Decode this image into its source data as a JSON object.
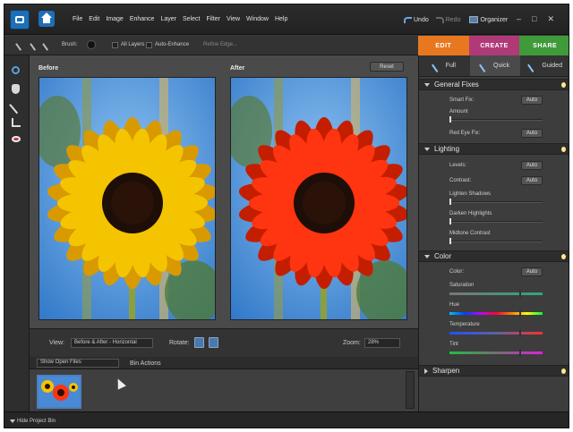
{
  "menubar": {
    "items": [
      "File",
      "Edit",
      "Image",
      "Enhance",
      "Layer",
      "Select",
      "Filter",
      "View",
      "Window",
      "Help"
    ],
    "undo_label": "Undo",
    "redo_label": "Redo",
    "organizer_label": "Organizer",
    "minimize": "–",
    "restore": "□",
    "close": "✕"
  },
  "options": {
    "brush_label": "Brush:",
    "all_layers_label": "All Layers",
    "auto_enhance_label": "Auto-Enhance",
    "refine_edge_label": "Refine Edge..."
  },
  "modes": {
    "edit": "EDIT",
    "create": "CREATE",
    "share": "SHARE"
  },
  "canvas": {
    "before_label": "Before",
    "after_label": "After",
    "reset_label": "Reset"
  },
  "viewbar": {
    "view_label": "View:",
    "view_value": "Before & After - Horizontal",
    "rotate_label": "Rotate:",
    "zoom_label": "Zoom:",
    "zoom_value": "28%"
  },
  "bin": {
    "show_value": "Show Open Files",
    "bin_actions_label": "Bin Actions",
    "hide_label": "Hide Project Bin"
  },
  "panel": {
    "tabs": [
      {
        "label": "Full"
      },
      {
        "label": "Quick"
      },
      {
        "label": "Guided"
      }
    ],
    "auto_label": "Auto",
    "general": {
      "title": "General Fixes",
      "smart_fix": "Smart Fix:",
      "amount": "Amount",
      "red_eye": "Red Eye Fix:"
    },
    "lighting": {
      "title": "Lighting",
      "levels": "Levels:",
      "contrast": "Contrast:",
      "lighten": "Lighten Shadows",
      "darken": "Darken Highlights",
      "midtone": "Midtone Contrast"
    },
    "color": {
      "title": "Color",
      "color": "Color:",
      "saturation": "Saturation",
      "hue": "Hue",
      "temperature": "Temperature",
      "tint": "Tint"
    },
    "sharpen": {
      "title": "Sharpen"
    }
  },
  "sliders": {
    "amount": 0.0,
    "lighten": 0.0,
    "darken": 0.0,
    "midtone": 0.0,
    "saturation": 0.75,
    "hue": 0.75,
    "temperature": 0.75,
    "tint": 0.75
  },
  "colors": {
    "accent_blue": "#1d6fb8",
    "edit_tab": "#e8781f",
    "create_tab": "#b03a78",
    "share_tab": "#3f9a3a",
    "before_flower": "#f5c400",
    "after_flower": "#ff3410"
  }
}
